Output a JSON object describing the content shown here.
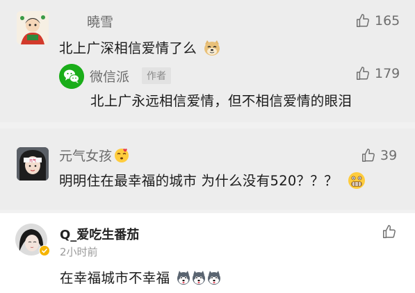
{
  "comments": [
    {
      "user": "曉雪",
      "text": "北上广深相信爱情了么",
      "likes": "165",
      "reply": {
        "user": "微信派",
        "badge": "作者",
        "text": "北上广永远相信爱情，但不相信爱情的眼泪",
        "likes": "179"
      }
    },
    {
      "user": "元气女孩",
      "text": "明明住在最幸福的城市 为什么没有520？？？",
      "likes": "39"
    },
    {
      "user": "Q_爱吃生番茄",
      "time": "2小时前",
      "text": "在幸福城市不幸福"
    }
  ],
  "icons": {
    "like": "thumbs-up-outline-icon",
    "verified": "verified-badge-icon",
    "wechat": "wechat-logo-icon"
  },
  "colors": {
    "wechat_green": "#1aad19",
    "verified_gold": "#f5b400"
  }
}
